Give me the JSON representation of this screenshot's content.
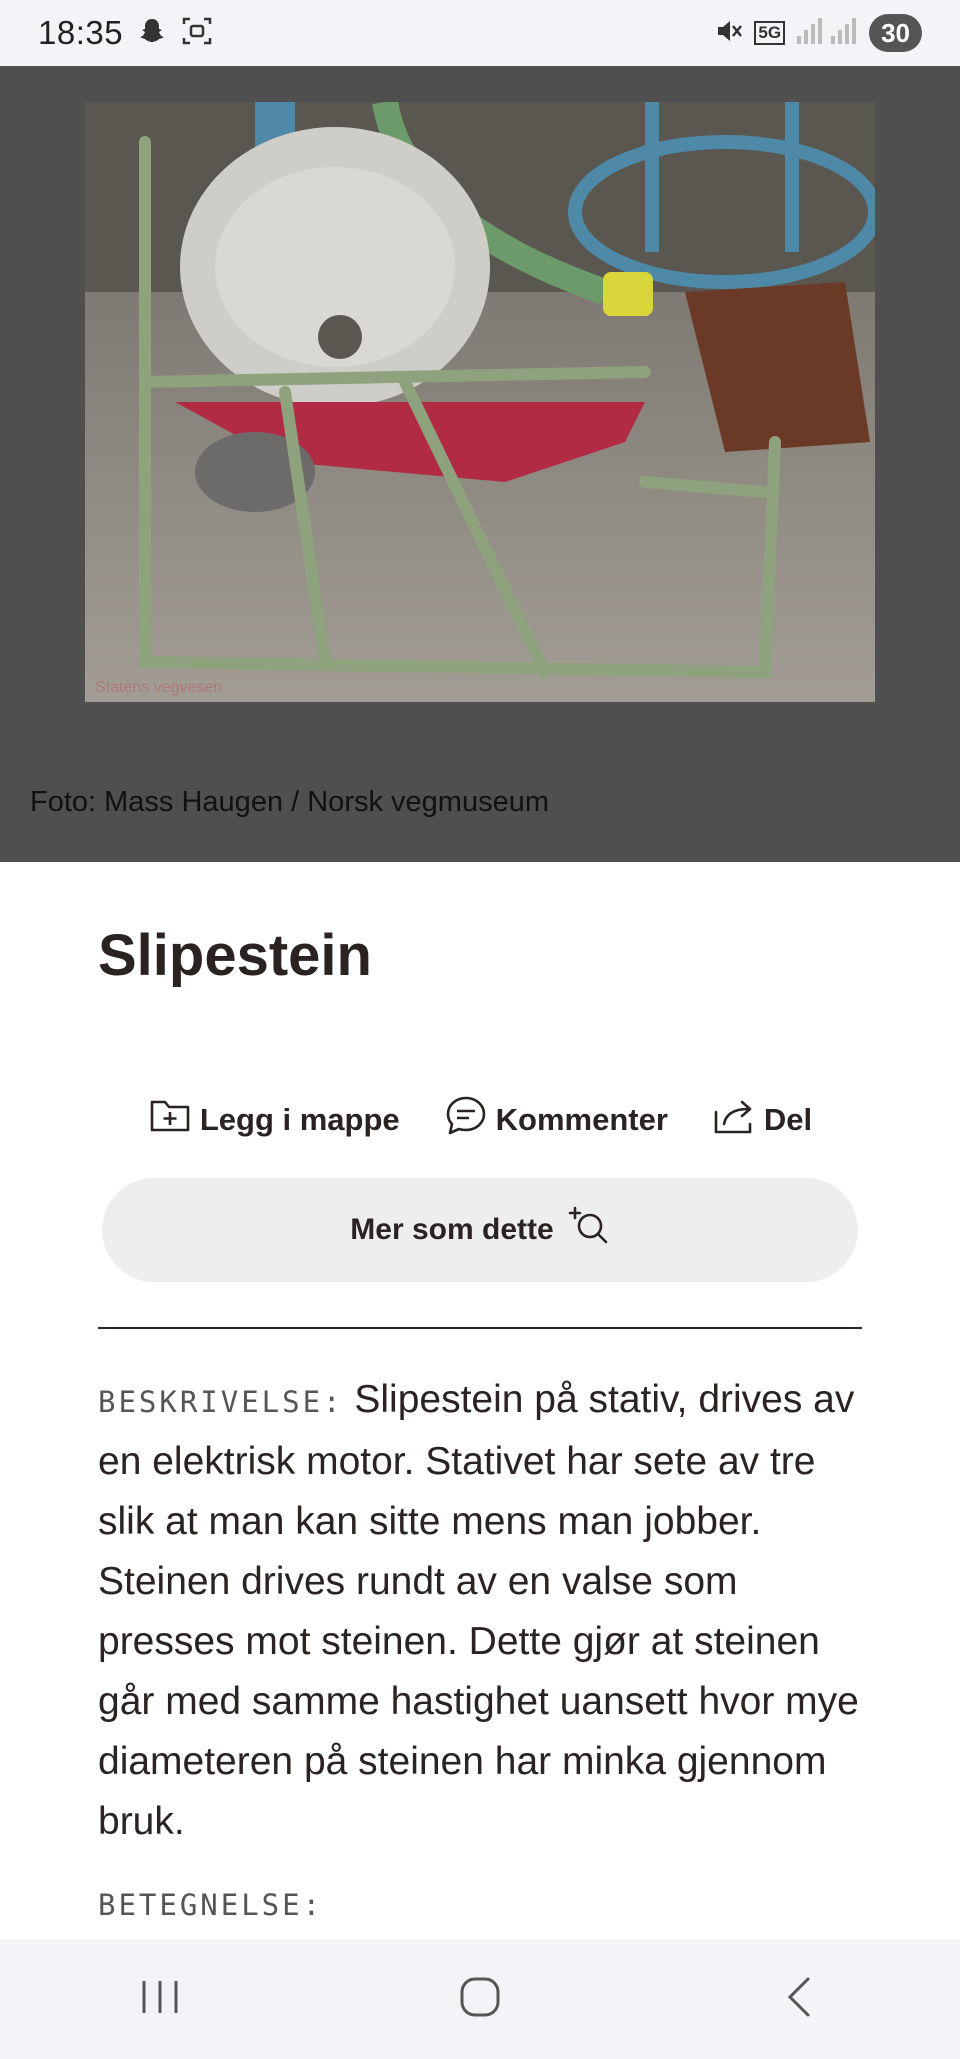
{
  "status_bar": {
    "time": "18:35",
    "network": "5G",
    "battery": "30"
  },
  "photo": {
    "alt": "Slipestein",
    "watermark": "Statens vegvesen",
    "caption": "Foto: Mass Haugen / Norsk vegmuseum"
  },
  "title": "Slipestein",
  "actions": {
    "folder_label": "Legg i mappe",
    "comment_label": "Kommenter",
    "share_label": "Del"
  },
  "more_button_label": "Mer som dette",
  "description": {
    "label": "BESKRIVELSE:",
    "text": "Slipestein på stativ, drives av en elektrisk motor. Stativet har sete av tre slik at man kan sitte mens man jobber. Steinen drives rundt av en valse som presses mot steinen. Dette gjør at steinen går med samme hastighet uansett hvor mye diameteren på steinen har minka gjennom bruk."
  },
  "designation_label": "BETEGNELSE:",
  "nav": {
    "recent_icon": "recent-apps-icon",
    "home_icon": "home-icon",
    "back_icon": "back-icon"
  }
}
